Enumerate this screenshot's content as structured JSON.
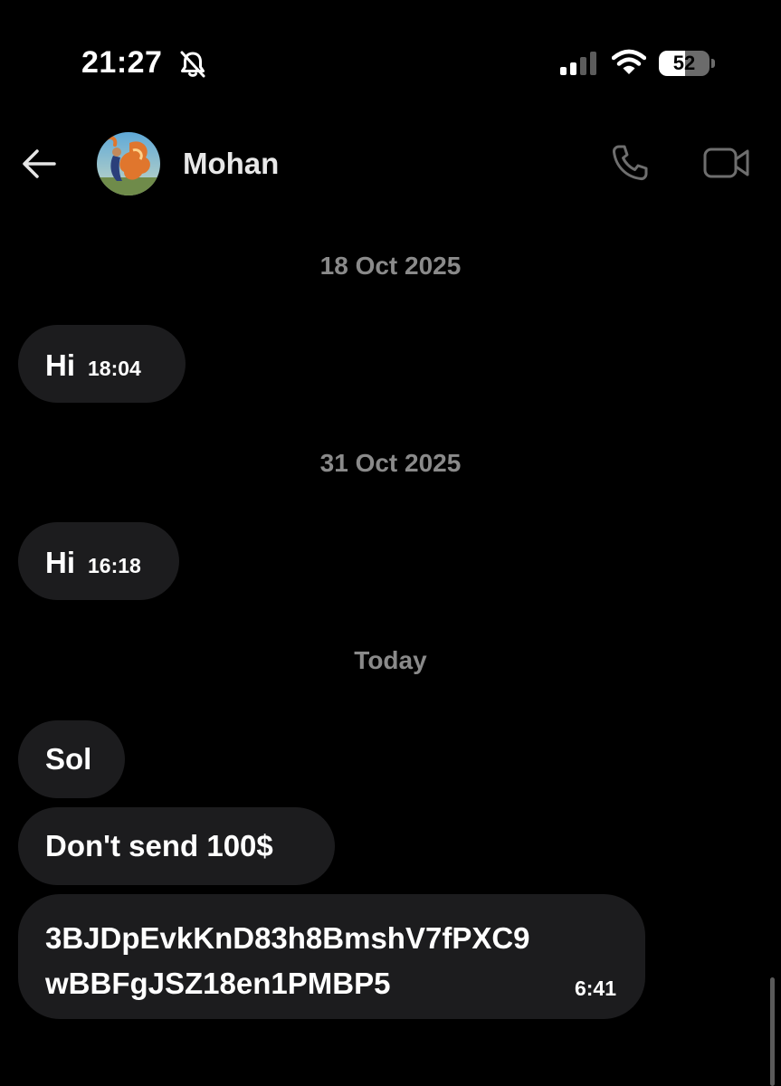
{
  "status_bar": {
    "time": "21:27",
    "battery_percent": 52,
    "battery_label": "52",
    "icons": [
      "bell-slash-icon",
      "signal-bars-icon",
      "wifi-icon",
      "battery-icon"
    ]
  },
  "header": {
    "contact_name": "Mohan",
    "icons": [
      "back-arrow-icon",
      "phone-icon",
      "video-camera-icon"
    ]
  },
  "chat": {
    "date_separators": [
      "18 Oct 2025",
      "31 Oct 2025",
      "Today"
    ],
    "messages": [
      {
        "text": "Hi",
        "time": "18:04"
      },
      {
        "text": "Hi",
        "time": "16:18"
      },
      {
        "text": "Sol",
        "time": ""
      },
      {
        "text": "Don't send 100$",
        "time": ""
      },
      {
        "text": "3BJDpEvkKnD83h8BmshV7fPXC9wBBFgJSZ18en1PMBP5",
        "time": "6:41"
      }
    ]
  },
  "colors": {
    "background": "#000000",
    "bubble": "#1c1c1e",
    "date_text": "#8a8a8a",
    "text": "#ffffff"
  }
}
